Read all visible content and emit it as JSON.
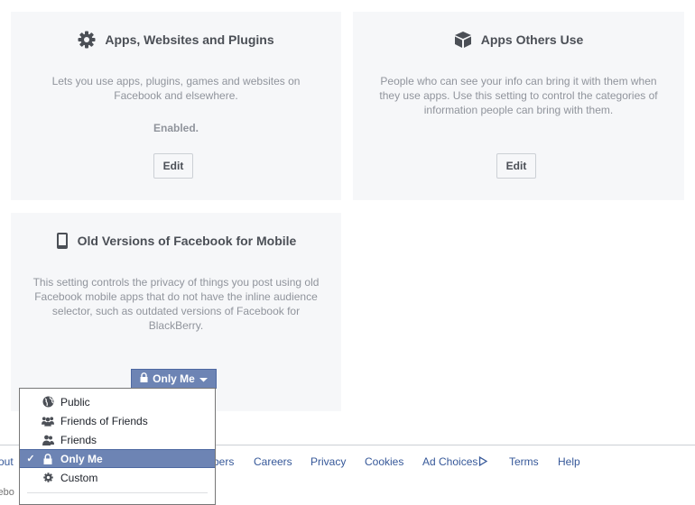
{
  "cards": {
    "apps_websites": {
      "title": "Apps, Websites and Plugins",
      "icon": "gear-icon",
      "description_lines": [
        "Lets you use apps, plugins, games and websites on",
        "Facebook and elsewhere."
      ],
      "status": "Enabled.",
      "button": "Edit"
    },
    "apps_others": {
      "title": "Apps Others Use",
      "icon": "cube-icon",
      "description_lines": [
        "People who can see your info can bring it with them when",
        "they use apps. Use this setting to control the categories of",
        "information people can bring with them."
      ],
      "button": "Edit"
    },
    "old_mobile": {
      "title": "Old Versions of Facebook for Mobile",
      "icon": "mobile-phone-icon",
      "description_lines": [
        "This setting controls the privacy of things you post using old",
        "Facebook mobile apps that do not have the inline audience",
        "selector, such as outdated versions of Facebook for",
        "BlackBerry."
      ],
      "audience_button": "Only Me"
    }
  },
  "audience_dropdown": {
    "selected": "Only Me",
    "options": [
      {
        "label": "Public",
        "icon": "globe-icon"
      },
      {
        "label": "Friends of Friends",
        "icon": "friends-of-friends-icon"
      },
      {
        "label": "Friends",
        "icon": "friends-icon"
      },
      {
        "label": "Only Me",
        "icon": "lock-icon",
        "check": "✓"
      },
      {
        "label": "Custom",
        "icon": "gear-icon"
      }
    ]
  },
  "footer": {
    "links": [
      "out",
      "bers",
      "Careers",
      "Privacy",
      "Cookies",
      "Ad Choices",
      "Terms",
      "Help"
    ],
    "copyright_fragment": "cebo"
  },
  "colors": {
    "card_bg": "#f6f7f9",
    "accent": "#6d84b4",
    "link": "#365899"
  }
}
